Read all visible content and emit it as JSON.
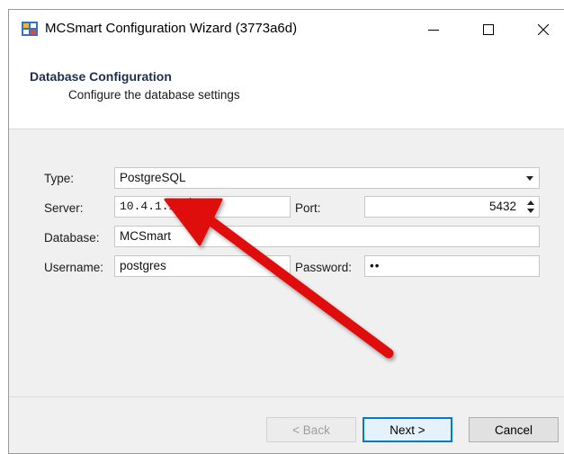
{
  "window": {
    "title": "MCSmart Configuration Wizard (3773a6d)",
    "icons": {
      "app": "app-icon",
      "minimize": "minimize-icon",
      "maximize": "maximize-icon",
      "close": "close-icon"
    }
  },
  "header": {
    "title": "Database Configuration",
    "subtitle": "Configure the database settings"
  },
  "form": {
    "type_label": "Type:",
    "type_value": "PostgreSQL",
    "server_label": "Server:",
    "server_value": "10.4.1.164",
    "port_label": "Port:",
    "port_value": "5432",
    "database_label": "Database:",
    "database_value": "MCSmart",
    "username_label": "Username:",
    "username_value": "postgres",
    "password_label": "Password:",
    "password_value": "••"
  },
  "buttons": {
    "back": "< Back",
    "next": "Next >",
    "cancel": "Cancel"
  },
  "colors": {
    "annotation_arrow": "#e01010",
    "accent": "#0078d7"
  }
}
